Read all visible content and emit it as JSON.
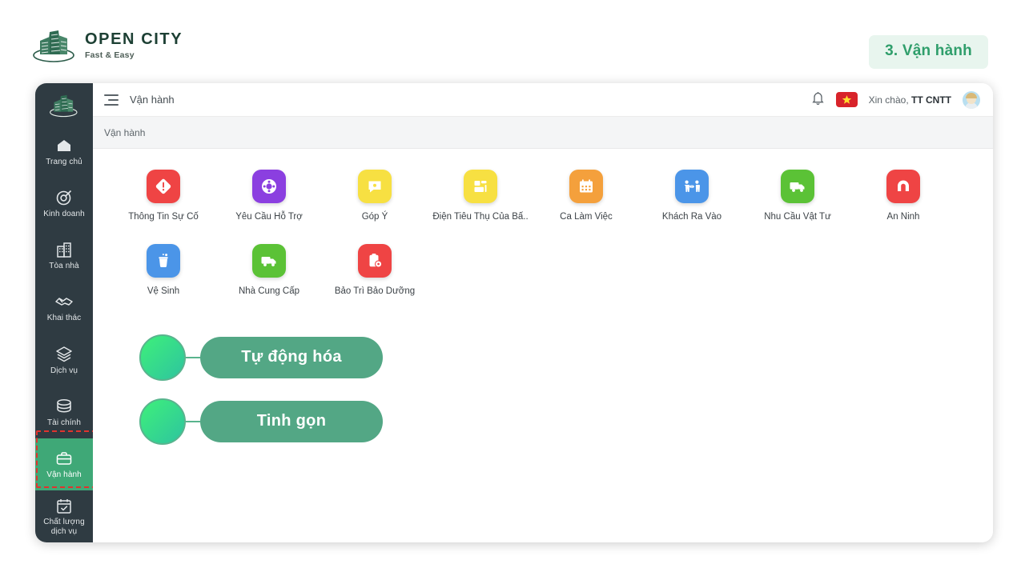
{
  "brand": {
    "title": "OPEN CITY",
    "tagline": "Fast & Easy",
    "logo_icon": "city-skyline-logo-icon"
  },
  "step_badge": {
    "label": "3. Vận hành",
    "bg": "#e8f5ee",
    "color": "#2f9e6b"
  },
  "sidebar": {
    "logo_icon": "city-skyline-logo-icon",
    "items": [
      {
        "label": "Trang chủ",
        "icon": "home-icon",
        "active": false
      },
      {
        "label": "Kinh doanh",
        "icon": "target-icon",
        "active": false
      },
      {
        "label": "Tòa nhà",
        "icon": "building-icon",
        "active": false
      },
      {
        "label": "Khai thác",
        "icon": "handshake-icon",
        "active": false
      },
      {
        "label": "Dịch vụ",
        "icon": "layers-icon",
        "active": false
      },
      {
        "label": "Tài chính",
        "icon": "database-icon",
        "active": false
      },
      {
        "label": "Vận hành",
        "icon": "briefcase-icon",
        "active": true
      },
      {
        "label": "Chất lượng\ndịch vụ",
        "icon": "calendar-check-icon",
        "active": false
      }
    ],
    "active_bg": "#3fa877",
    "highlight_color": "#e0332e"
  },
  "topbar": {
    "menu_icon": "hamburger-icon",
    "title": "Vận hành",
    "bell_icon": "bell-icon",
    "flag_icon": "vietnam-flag-icon",
    "greeting_prefix": "Xin chào, ",
    "user_name": "TT CNTT",
    "avatar_icon": "user-avatar"
  },
  "breadcrumb": {
    "text": "Vận hành"
  },
  "tiles": [
    {
      "label": "Thông Tin Sự Cố",
      "icon": "warning-diamond-icon",
      "color": "#ef4444"
    },
    {
      "label": "Yêu Cầu Hỗ Trợ",
      "icon": "lifebuoy-icon",
      "color": "#8b3fe0"
    },
    {
      "label": "Góp Ý",
      "icon": "chat-feedback-icon",
      "color": "#f7e042"
    },
    {
      "label": "Điện Tiêu Thụ Của Bấ..",
      "icon": "dashboard-blocks-icon",
      "color": "#f7e042"
    },
    {
      "label": "Ca Làm Việc",
      "icon": "calendar-icon",
      "color": "#f4a03c"
    },
    {
      "label": "Khách Ra Vào",
      "icon": "visitors-inout-icon",
      "color": "#4b95e8"
    },
    {
      "label": "Nhu Cầu Vật Tư",
      "icon": "delivery-truck-icon",
      "color": "#5bc236"
    },
    {
      "label": "An Ninh",
      "icon": "security-shield-icon",
      "color": "#ef4444"
    },
    {
      "label": "Vệ Sinh",
      "icon": "trash-clean-icon",
      "color": "#4b95e8"
    },
    {
      "label": "Nhà Cung Cấp",
      "icon": "delivery-truck-icon",
      "color": "#5bc236"
    },
    {
      "label": "Bảo Trì Bảo Dưỡng",
      "icon": "clipboard-gear-icon",
      "color": "#ef4444"
    }
  ],
  "callouts": [
    {
      "label": "Tự động hóa"
    },
    {
      "label": "Tinh gọn"
    }
  ],
  "theme": {
    "callout_pill": "#53a785",
    "callout_dot_from": "#3ef07a",
    "callout_dot_to": "#2ec49f",
    "sidebar_bg": "#2f3b42"
  }
}
